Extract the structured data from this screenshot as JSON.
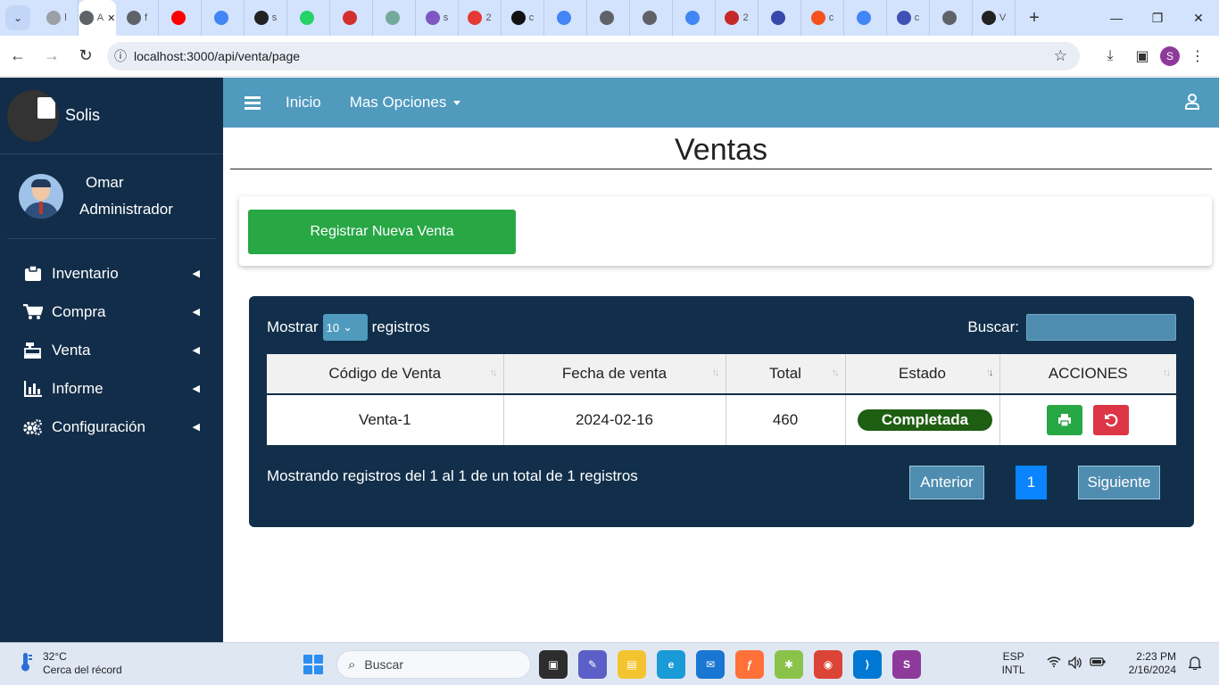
{
  "browser": {
    "url": "localhost:3000/api/venta/page",
    "profile_initial": "S"
  },
  "tabs": [
    {
      "label": "l",
      "color": "#9aa0a6"
    },
    {
      "label": "A",
      "color": "#5f6368",
      "active": true
    },
    {
      "label": "f",
      "color": "#5f6368"
    },
    {
      "label": "",
      "color": "#ff0000"
    },
    {
      "label": "",
      "color": "#4285f4"
    },
    {
      "label": "s",
      "color": "#222222"
    },
    {
      "label": "",
      "color": "#25d366"
    },
    {
      "label": "",
      "color": "#d32f2f"
    },
    {
      "label": "",
      "color": "#74aa9c"
    },
    {
      "label": "s",
      "color": "#7e57c2"
    },
    {
      "label": "2",
      "color": "#e53935"
    },
    {
      "label": "c",
      "color": "#111111"
    },
    {
      "label": "",
      "color": "#4285f4"
    },
    {
      "label": "",
      "color": "#5f6368"
    },
    {
      "label": "",
      "color": "#5f6368"
    },
    {
      "label": "",
      "color": "#4285f4"
    },
    {
      "label": "2",
      "color": "#c62828"
    },
    {
      "label": "",
      "color": "#3949ab"
    },
    {
      "label": "c",
      "color": "#f4511e"
    },
    {
      "label": "",
      "color": "#4285f4"
    },
    {
      "label": "c",
      "color": "#3f51b5"
    },
    {
      "label": "",
      "color": "#5f6368"
    },
    {
      "label": "V",
      "color": "#222222"
    }
  ],
  "sidebar": {
    "brand": "Solis",
    "user_name": "Omar",
    "user_role": "Administrador",
    "items": [
      {
        "label": "Inventario"
      },
      {
        "label": "Compra"
      },
      {
        "label": "Venta"
      },
      {
        "label": "Informe"
      },
      {
        "label": "Configuración"
      }
    ]
  },
  "topnav": {
    "home": "Inicio",
    "more": "Mas Opciones"
  },
  "page": {
    "title": "Ventas",
    "new_sale_button": "Registrar Nueva Venta"
  },
  "table": {
    "length_label_before": "Mostrar",
    "length_value": "10",
    "length_label_after": "registros",
    "search_label": "Buscar:",
    "columns": [
      "Código de Venta",
      "Fecha de venta",
      "Total",
      "Estado",
      "ACCIONES"
    ],
    "rows": [
      {
        "codigo": "Venta-1",
        "fecha": "2024-02-16",
        "total": "460",
        "estado": "Completada"
      }
    ],
    "info": "Mostrando registros del 1 al 1 de un total de 1 registros",
    "prev": "Anterior",
    "page": "1",
    "next": "Siguiente"
  },
  "taskbar": {
    "temp": "32°C",
    "weather": "Cerca del récord",
    "search_placeholder": "Buscar",
    "lang1": "ESP",
    "lang2": "INTL",
    "time": "2:23 PM",
    "date": "2/16/2024"
  },
  "colors": {
    "sidebar": "#122d49",
    "topnav": "#4f9abd",
    "success": "#28a745",
    "danger": "#dc3545",
    "primary": "#0a84ff"
  }
}
